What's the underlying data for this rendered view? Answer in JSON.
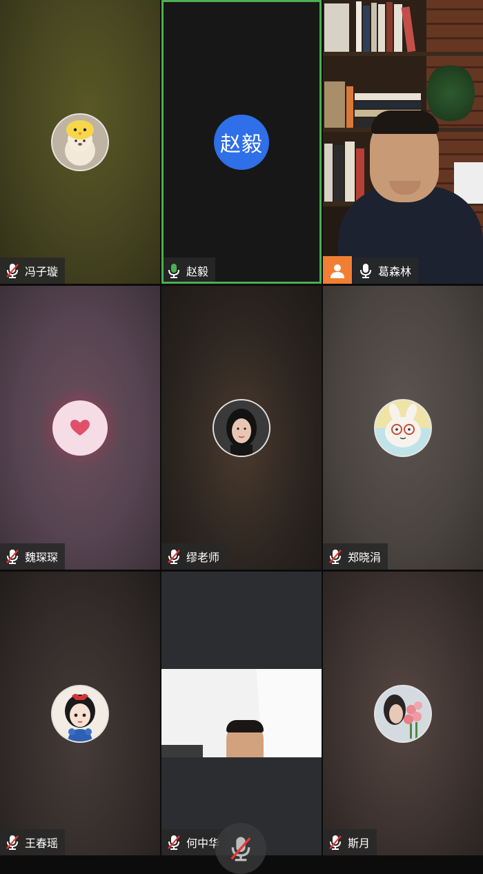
{
  "participants": [
    {
      "name": "冯子璇",
      "mic": "muted",
      "avatar": "duck-bear-avatar"
    },
    {
      "name": "赵毅",
      "mic": "speaking",
      "avatar_text": "赵毅",
      "active": true
    },
    {
      "name": "葛森林",
      "mic": "on",
      "video": true
    },
    {
      "name": "魏琛琛",
      "mic": "muted",
      "avatar": "heart-avatar"
    },
    {
      "name": "缪老师",
      "mic": "muted",
      "avatar": "woman-photo-avatar"
    },
    {
      "name": "郑晓涓",
      "mic": "muted",
      "avatar": "cartoon-rabbit-avatar"
    },
    {
      "name": "王春瑶",
      "mic": "muted",
      "avatar": "princess-avatar"
    },
    {
      "name": "何中华",
      "mic": "muted",
      "video": true
    },
    {
      "name": "斯月",
      "mic": "muted",
      "avatar": "flowers-photo-avatar"
    }
  ],
  "colors": {
    "active_border": "#4caf50",
    "speaking_mic": "#4caf50",
    "muted_slash": "#e53935",
    "avatar_blue": "#2f6fe8",
    "person_badge": "#f07f34"
  },
  "controls": {
    "floating_mic": "muted"
  }
}
